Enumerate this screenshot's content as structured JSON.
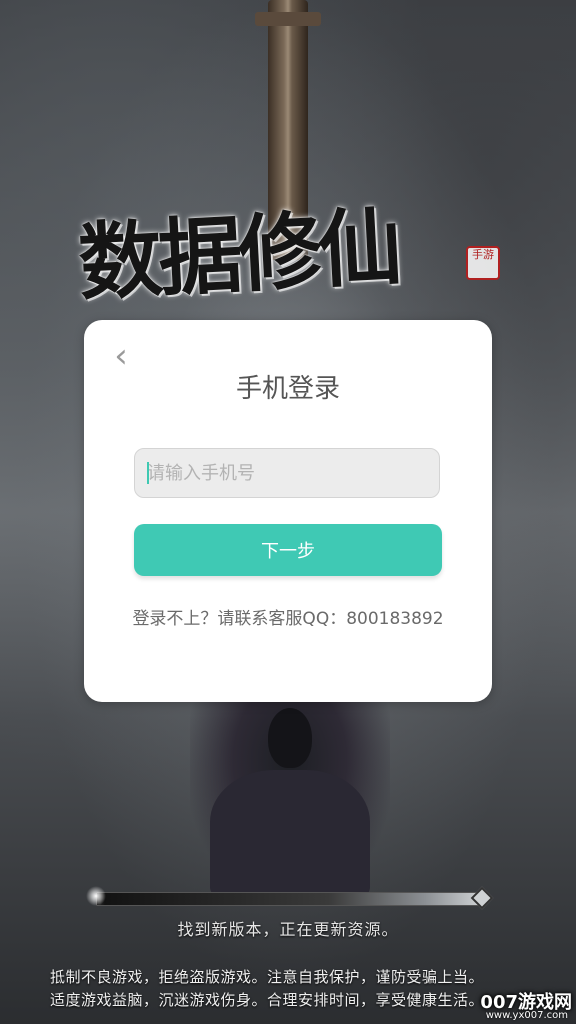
{
  "game": {
    "logo_text": "数据修仙",
    "seal_text": "手游"
  },
  "login_dialog": {
    "back_icon": "‹",
    "title": "手机登录",
    "phone_placeholder": "请输入手机号",
    "phone_value": "",
    "next_label": "下一步",
    "support_text": "登录不上？请联系客服QQ：800183892",
    "accent_color": "#3fc9b4"
  },
  "loading": {
    "progress": 0.02,
    "status_text": "找到新版本，正在更新资源。"
  },
  "health_notice": {
    "line1": "抵制不良游戏，拒绝盗版游戏。注意自我保护，谨防受骗上当。",
    "line2": "适度游戏益脑，沉迷游戏伤身。合理安排时间，享受健康生活。"
  },
  "watermark": {
    "text": "007游戏网",
    "url": "www.yx007.com"
  }
}
